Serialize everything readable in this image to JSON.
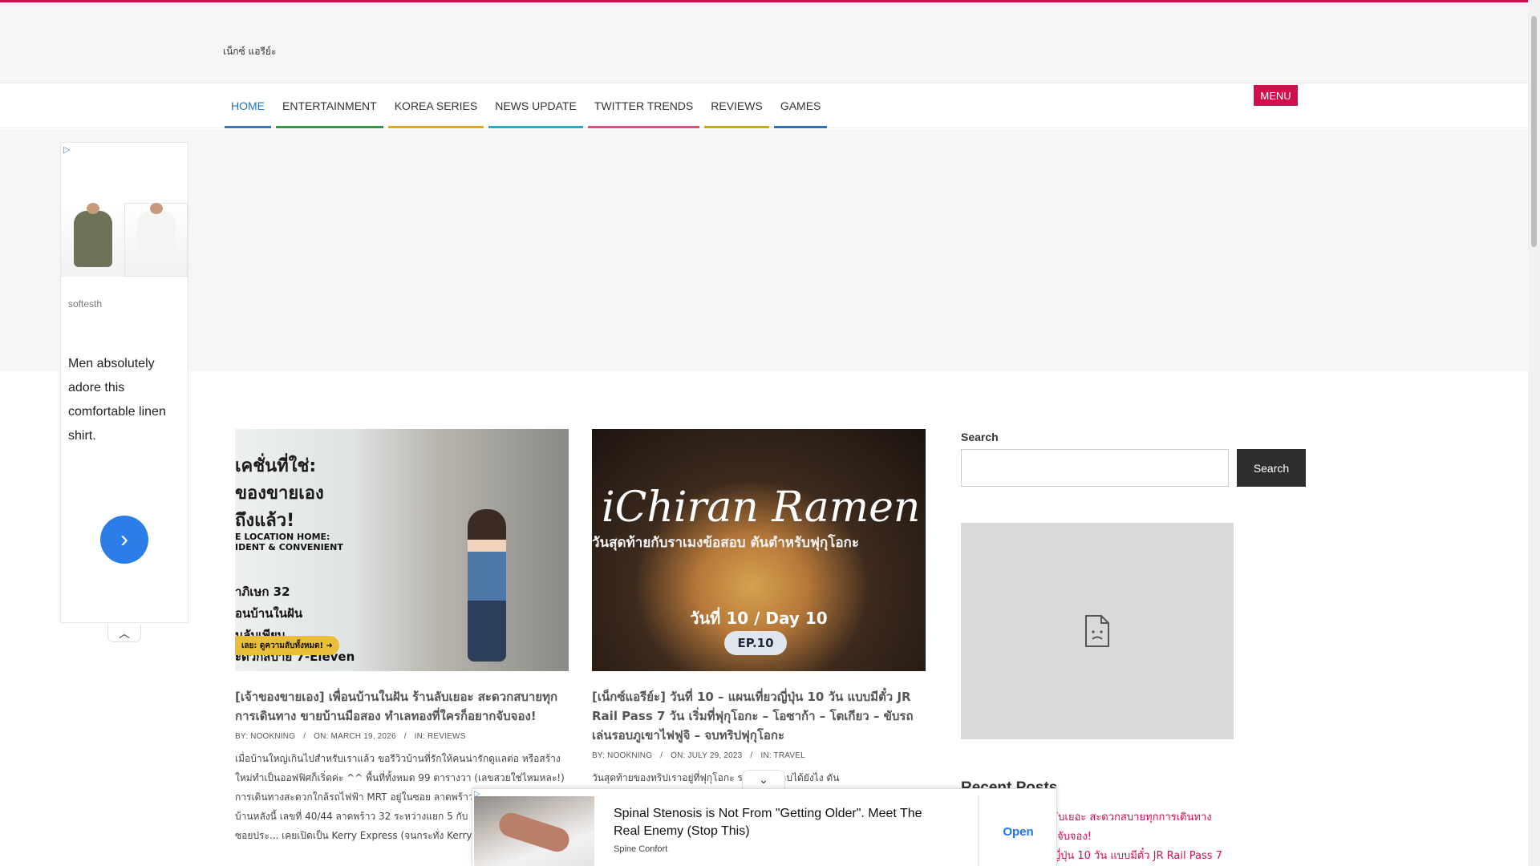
{
  "site": {
    "title": "เน็กซ์ แอรีย์ะ"
  },
  "nav": {
    "items": [
      {
        "label": "HOME",
        "active": true,
        "underline": "#3a74c0"
      },
      {
        "label": "ENTERTAINMENT",
        "underline": "#2e9a44"
      },
      {
        "label": "KOREA SERIES",
        "underline": "#e5a628"
      },
      {
        "label": "NEWS UPDATE",
        "underline": "#2fa7c9"
      },
      {
        "label": "TWITTER TRENDS",
        "underline": "#dd4f7e"
      },
      {
        "label": "REVIEWS",
        "underline": "#c3ad1d"
      },
      {
        "label": "GAMES",
        "underline": "#2c71c3"
      }
    ],
    "menu_label": "MENU"
  },
  "side_ad": {
    "brand": "softesth",
    "text": "Men absolutely adore this comfortable linen shirt.",
    "arrow": "›",
    "collapse_glyph": "︿"
  },
  "posts": [
    {
      "thumb_lines": [
        "เคชั่นที่ใช่:",
        "ของขายเอง",
        "ถึงแล้ว!"
      ],
      "thumb_sub": [
        "E LOCATION HOME:",
        "IDENT & CONVENIENT"
      ],
      "thumb_lines2": [
        "าภิเษก 32",
        "อนบ้านในฝัน",
        "นลับเพียบ",
        "ะดวกสบาย 7-Eleven"
      ],
      "thumb_pill": "เลย: ดูความลับทั้งหมด! ➜",
      "title": "[เจ้าของขายเอง] เพื่อนบ้านในฝัน ร้านลับเยอะ สะดวกสบายทุกการเดินทาง ขายบ้านมือสอง ทำเลทองที่ใครก็อยากจับจอง!",
      "author": "NOOKNING",
      "date": "MARCH 19, 2026",
      "category": "REVIEWS",
      "excerpt": "เมื่อบ้านใหญ่เกินไปสำหรับเราแล้ว ขอรีวิวบ้านที่รักให้คนน่ารักดูแลต่อ หรือสร้างใหม่ทำเป็นออฟฟิศก็เริ่ดค่ะ ^^ พื้นที่ทั้งหมด 99 ตารางวา (เลขสวยใช่ไหมหละ!) การเดินทางสะดวกใกล้รถไฟฟ้า MRT อยู่ในซอย ลาดพร้าว รัชโยธิน และวังหิน บ้านหลังนี้ เลขที่ 40/44 ลาดพร้าว 32 ระหว่างแยก 5 กับ แยก 7 เดินจิตจากปากซอยประ... เคยเปิดเป็น Kerry Express (จนกระทั่ง Kerry ปิด"
    },
    {
      "thumb_script": "iChiran Ramen",
      "thumb_th": "วันสุดท้ายกับราเมงข้อสอบ ตันตำหรับฟุกุโอกะ",
      "thumb_day": "วันที่ 10 / Day 10",
      "thumb_ep": "EP.10",
      "title": "[เน็กซ์แอรีย์ะ] วันที่ 10 – แผนเที่ยวญี่ปุ่น 10 วัน แบบมีตั๋ว JR Rail Pass 7 วัน เริ่มที่ฟุกุโอกะ – โอซาก้า – โตเกียว – ขับรถเล่นรอบภูเขาไฟฟูจิ – จบทริปฟุกุโอกะ",
      "author": "NOOKNING",
      "date": "JULY 29, 2023",
      "category": "TRAVEL",
      "excerpt": "วันสุดท้ายของทริปเราอยู่ที่ฟุกุโอกะ ราเมงข้อสอบได้ยังไง ตัน"
    }
  ],
  "meta_labels": {
    "by": "BY:",
    "on": "ON:",
    "in": "IN:",
    "slash": "/"
  },
  "sidebar": {
    "search_label": "Search",
    "search_button": "Search",
    "search_value": "",
    "recent_title": "Recent Posts",
    "recent": [
      "เพื่อนบ้านในฝัน ร้านลับเยอะ สะดวกสบายทุกการเดินทาง",
      "ทำเลทองที่ใครก็อยากจับจอง!",
      "วันที่ 10 – แผนเที่ยวญี่ปุ่น 10 วัน แบบมีตั๋ว JR Rail Pass 7"
    ]
  },
  "bottom_ad": {
    "headline": "Spinal Stenosis is Not From \"Getting Older\". Meet The Real Enemy (Stop This)",
    "brand": "Spine Confort",
    "cta": "Open",
    "collapse_glyph": "⌄"
  },
  "icons": {
    "adchoices": "adchoices-icon",
    "broken_image": "broken-image-icon",
    "arrow": "chevron-right-icon"
  }
}
